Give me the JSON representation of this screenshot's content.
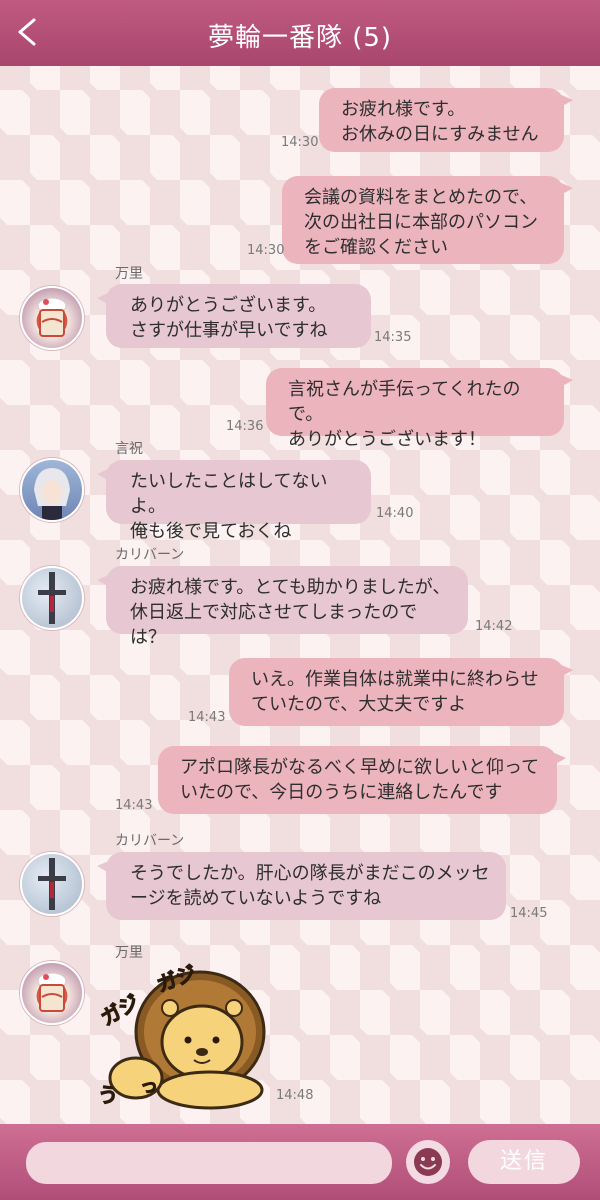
{
  "header": {
    "title": "夢輪一番隊 (5)",
    "back_icon": "chevron-left-icon"
  },
  "messages": [
    {
      "text": "お疲れ様です。\nお休みの日にすみません",
      "time": "14:30"
    },
    {
      "text": "会議の資料をまとめたので、\n次の出社日に本部のパソコン\nをご確認ください",
      "time": "14:30"
    },
    {
      "sender": "万里",
      "text": "ありがとうございます。\nさすが仕事が早いですね",
      "time": "14:35"
    },
    {
      "text": "言祝さんが手伝ってくれたので。\nありがとうございます！",
      "time": "14:36"
    },
    {
      "sender": "言祝",
      "text": "たいしたことはしてないよ。\n俺も後で見ておくね",
      "time": "14:40"
    },
    {
      "sender": "カリバーン",
      "text": "お疲れ様です。とても助かりましたが、\n休日返上で対応させてしまったのでは？",
      "time": "14:42"
    },
    {
      "text": "いえ。作業自体は就業中に終わらせ\nていたので、大丈夫ですよ",
      "time": "14:43"
    },
    {
      "text": "アポロ隊長がなるべく早めに欲しいと仰って\nいたので、今日のうちに連絡したんです",
      "time": "14:43"
    },
    {
      "sender": "カリバーン",
      "text": "そうでしたか。肝心の隊長がまだこのメッセ\nージを読めていないようですね",
      "time": "14:45"
    },
    {
      "sender": "万里",
      "sticker_text": "うっ ガジガジ",
      "time": "14:48"
    }
  ],
  "footer": {
    "send_label": "送信",
    "emoji_icon": "smiley-face-icon",
    "input_value": ""
  },
  "colors": {
    "header": "#b04e78",
    "bubble_out": "#ecb4bd",
    "bubble_in": "#e6c7d2",
    "footer": "#cf6f93"
  }
}
